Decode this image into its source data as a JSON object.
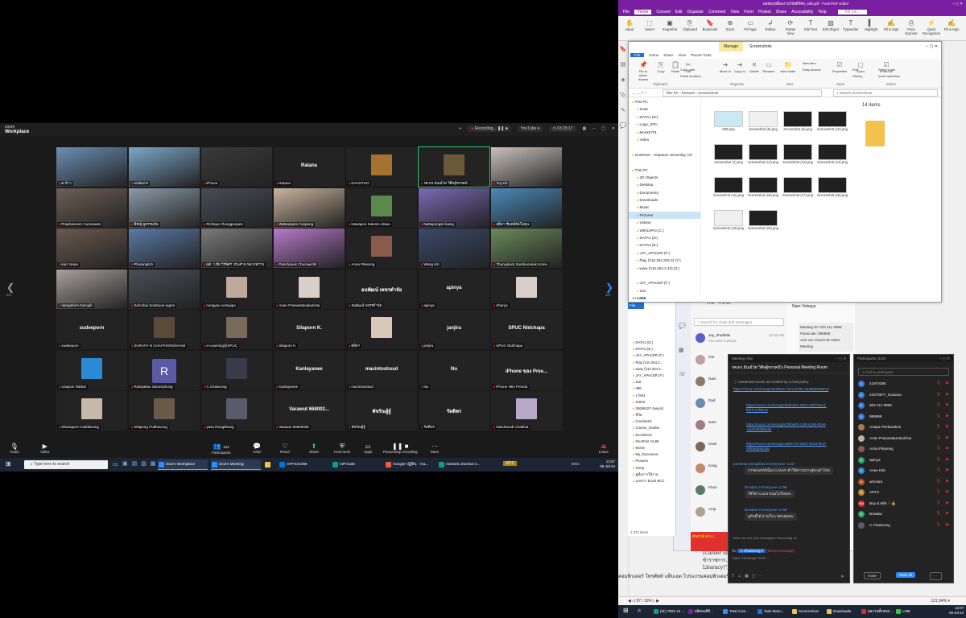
{
  "zoom": {
    "brand_small": "zoom",
    "brand": "Workplace",
    "recording": "Recording...",
    "youtube": "YouTube",
    "timer": "03:29:17",
    "page_left": "1/2",
    "page_right": "1/2",
    "tiles": [
      {
        "label": "ต.ข้าว",
        "photo": "#6b8fb3"
      },
      {
        "label": "Kittikal R",
        "photo": "#7aa8c9"
      },
      {
        "label": "iPhone",
        "photo": "#3a3a3a"
      },
      {
        "label": "Ratana",
        "big": "Ratana"
      },
      {
        "label": "KHAOTOO",
        "thumb": "#a5732f"
      },
      {
        "label": "รศ.ดร.ธันณ์วัต วิศิษฐ์ทรรศน์",
        "thumb": "#6a5a3a",
        "active": true
      },
      {
        "label": "Yuy Kit",
        "photo": "#c9c2bd"
      },
      {
        "label": "Praphansorn Cumnawat",
        "photo": "#6d5f54"
      },
      {
        "label": "พิชญ์ ยูธรรมมั่น",
        "photo": "#8a9aa7"
      },
      {
        "label": "Pichaya Chongpoopen",
        "photo": "#4a4c55"
      },
      {
        "label": "Watsanpam Fanpeng",
        "photo": "#c9b39e"
      },
      {
        "label": "Nawapon Kalumn Jitsan",
        "thumb": "#5a8a4a"
      },
      {
        "label": "Nuttapongsri kaing",
        "photo": "#7a6ab5"
      },
      {
        "label": "สสิตา ชีมคอีย์อโม่ดุน",
        "photo": "#4a8ab9"
      },
      {
        "label": "karc Nana",
        "photo": "#6a5a4f"
      },
      {
        "label": "Phutanpitch",
        "photo": "#5a7aa5"
      },
      {
        "label": "ผศ. ว.ชัย วีรพิศฯ ประศาน หลวงทราม",
        "photo": "#7a7a7a"
      },
      {
        "label": "Parichanok Chumwichit",
        "photo": "#b87acc"
      },
      {
        "label": "Anna Pilasong",
        "thumb": "#8a5a4a"
      },
      {
        "label": "Wong Kiti",
        "photo": "#3a4a6a"
      },
      {
        "label": "Thunyaluck Somboonsuk Koreo",
        "photo": "#6a8a5a"
      },
      {
        "label": "Vanaphorn Damjab",
        "photo": "#a8a0a0"
      },
      {
        "label": "Somchai Somboon-ngern",
        "photo": "#4a4f55"
      },
      {
        "label": "nongyao somjaipo",
        "thumb": "#c0a89a"
      },
      {
        "label": "Anan Praewattanakulchai",
        "thumb": "#d8d0c8"
      },
      {
        "label": "อนพัฒน์ เพชรดำจัย",
        "big": "อนพัฒน์ เพชรดำจัย"
      },
      {
        "label": "apinya",
        "big": "apinya"
      },
      {
        "label": "Sharya",
        "thumb": "#d8d0c8"
      },
      {
        "label": "sudeeporn",
        "big": "sudeeporn"
      },
      {
        "label": "SURATH N CHAITHONGKHAM",
        "thumb": "#5a4a3a"
      },
      {
        "label": "e-Learning@SPUC",
        "thumb": "#7a6a5a"
      },
      {
        "label": "Silaporn  K.",
        "big": "Silaporn  K."
      },
      {
        "label": "ศุลิตา",
        "thumb": "#d8c8b8"
      },
      {
        "label": "janjira",
        "big": "janjira"
      },
      {
        "label": "SPUC Nidchapa",
        "big": "SPUC Nidchapa"
      },
      {
        "label": "Urapom Rattra!",
        "thumb": "#2a8ad5"
      },
      {
        "label": "Rattiyakan Samerphong",
        "letter": "R"
      },
      {
        "label": "C.Chaiarong",
        "thumb": "#3a3a4a"
      },
      {
        "label": "Kanlayanee",
        "big": "Kanlayanee"
      },
      {
        "label": "macintoshssd",
        "big": "macintoshssd"
      },
      {
        "label": "Nu",
        "big": "Nu"
      },
      {
        "label": "iPhone ของ Preeda",
        "big": "iPhone ของ Pree..."
      },
      {
        "label": "Dhanaporn Kaiklaivong",
        "thumb": "#c8b8a8"
      },
      {
        "label": "Sittipong Putthavong",
        "thumb": "#6a5a4a"
      },
      {
        "label": "yasa thongkhang",
        "thumb": "#5a5a6a"
      },
      {
        "label": "Varawut 66800005",
        "big": "Varawut 668002..."
      },
      {
        "label": "พัชรัณฐ์ฐ์",
        "big": "พัชรัณฐ์ฐ์"
      },
      {
        "label": "รัตติพร",
        "big": "รัตติพร"
      },
      {
        "label": "Natcharedt Chakhat",
        "thumb": "#b8a8c8"
      }
    ],
    "toolbar": {
      "audio": "Audio",
      "video": "Video",
      "participants": "Participants",
      "participants_count": "124",
      "chat": "Chat",
      "react": "React",
      "share": "Share",
      "host_tools": "Host tools",
      "apps": "Apps",
      "record": "Pause/stop recording",
      "more": "More",
      "leave": "Leave"
    }
  },
  "taskbar_left": {
    "search": "Type here to search",
    "apps": [
      {
        "label": "Zoom Workplace",
        "color": "#2d8cff",
        "on": true
      },
      {
        "label": "Zoom Meeting",
        "color": "#2d8cff",
        "on": true
      },
      {
        "label": "",
        "color": "#f4c542"
      },
      {
        "label": "OFFICE365",
        "color": "#0078d4"
      },
      {
        "label": "InPrivate",
        "color": "#0e9d8c"
      },
      {
        "label": "Google ปฏิทิน - ma...",
        "color": "#f15b40"
      },
      {
        "label": "misweb.chonbur.s...",
        "color": "#0e9d8c"
      }
    ],
    "weather": "32°C",
    "lang": "ENG",
    "time": "12:07",
    "date": "06-Jul-24"
  },
  "pdf": {
    "title": "ผลสัมฤทธิ์ผลงานวิจัยดิจิทัล_edit.pdf - Foxit PDF Editor",
    "menus": [
      "File",
      "Home",
      "Convert",
      "Edit",
      "Organize",
      "Comment",
      "View",
      "Form",
      "Protect",
      "Share",
      "Accessibility",
      "Help"
    ],
    "tell_me": "Tell me...",
    "ribbon": [
      "Hand",
      "Select",
      "SnapShot",
      "Clipboard",
      "Bookmark",
      "Zoom",
      "Fit Page",
      "Reflow",
      "Rotate View",
      "Edit Text",
      "Edit Object",
      "Typewriter",
      "Highlight",
      "Fill & Sign",
      "From Scanner",
      "Quick Recognition",
      "Fill & Sign"
    ],
    "doc_lines": [
      "(Career an...",
      "ข้าราชการ...",
      "Literacy)\"...",
      "คอมพิวเตอร์ โทรศัพท์ แท็บเลต โปรแกรมคอมพิวเตอร์ และสื่อออนไลน์ มาใช้ให้เกิดประโยชน์สูงสุด"
    ],
    "page": "97 / 324",
    "zoom_level": "121.94%"
  },
  "explorer": {
    "title": "Screenshots",
    "manage": "Manage",
    "tabs": [
      "File",
      "Home",
      "Share",
      "View",
      "Picture Tools"
    ],
    "ribbon": [
      "Pin to Quick access",
      "Copy",
      "Paste",
      "Cut",
      "Copy path",
      "Paste shortcut",
      "Move to",
      "Copy to",
      "Delete",
      "Rename",
      "New folder",
      "New item",
      "Easy access",
      "Properties",
      "Open",
      "Edit",
      "History",
      "Select all",
      "Select none",
      "Invert selection"
    ],
    "groups": [
      "Clipboard",
      "Organize",
      "New",
      "Open",
      "Select"
    ],
    "path": "This PC  ›  Pictures  ›  Screenshots",
    "search": "Search Screenshots",
    "count": "14 items",
    "nav": [
      "This PC",
      "Scan",
      "DATA1 (D:)",
      "Logo_SPU",
      "Monkh701",
      "Video",
      "",
      "OneDrive - Sripatum University, Ch",
      "",
      "This PC",
      "3D Objects",
      "Desktop",
      "Documents",
      "Downloads",
      "Music",
      "Pictures",
      "Videos",
      "WIN10Pro (C:)",
      "DATA1 (D:)",
      "DATA2 (E:)",
      "JAY_APACER (F:)",
      "Pjay (\\\\10.254.202.2) (Y:)",
      "www (\\\\10.254.2.43) (Z:)",
      "",
      "JAY_APACER (F:)",
      "118",
      "498"
    ],
    "files": [
      {
        "name": "838.png",
        "c": "#cde8f5"
      },
      {
        "name": "Screenshot (9).png",
        "c": "#f0f0f0"
      },
      {
        "name": "Screenshot (6).png",
        "c": "#202020"
      },
      {
        "name": "Screenshot (10).png",
        "c": "#202020"
      },
      {
        "name": "Screenshot (1).png",
        "c": "#202020"
      },
      {
        "name": "Screenshot (12).png",
        "c": "#202020"
      },
      {
        "name": "Screenshot (13).png",
        "c": "#202020"
      },
      {
        "name": "Screenshot (14).png",
        "c": "#202020"
      },
      {
        "name": "Screenshot (15).png",
        "c": "#202020"
      },
      {
        "name": "Screenshot (16).png",
        "c": "#202020"
      },
      {
        "name": "Screenshot (17).png",
        "c": "#202020"
      },
      {
        "name": "Screenshot (18).png",
        "c": "#202020"
      },
      {
        "name": "Screenshot (19).png",
        "c": "#f0f0f0"
      },
      {
        "name": "Screenshot (20).png",
        "c": "#202020"
      }
    ],
    "status": "14 items"
  },
  "explorer2": {
    "rows": [
      "DATA1 (D:)",
      "DATA2 (E:)",
      "JAY_APACER (F:)",
      "Pjay (\\\\10.254.2...",
      "www (\\\\10.254.2...",
      "JAY_APACER (F:)",
      "118",
      "498",
      "17804",
      "11810",
      "25658427-Jaeyod",
      "ชีวิต",
      "Condo610",
      "Course_Outline",
      "Excel2013",
      "FlexPrint 10.89",
      "Movie",
      "My_Document",
      "Pictures",
      "Temp",
      "คู่มือการใช้งาน",
      "เอกสาร Excel BCC"
    ],
    "status": "1,373 items"
  },
  "teams": {
    "tab_chat": "Chat",
    "tab_friends": "Friends",
    "search": "Search for chats and messages",
    "contacts": [
      {
        "name": "Jay_iPadMini",
        "preview": "You sent a photo.",
        "time": "11:03 AM"
      },
      {
        "name": "Om",
        "preview": "",
        "time": ""
      },
      {
        "name": "Nam",
        "preview": "",
        "time": ""
      },
      {
        "name": "Dad",
        "preview": "",
        "time": ""
      },
      {
        "name": "Nam",
        "preview": "",
        "time": ""
      },
      {
        "name": "Orak",
        "preview": "",
        "time": ""
      },
      {
        "name": "Kong",
        "preview": "",
        "time": ""
      },
      {
        "name": "Khun",
        "preview": "",
        "time": ""
      },
      {
        "name": "Amp",
        "preview": "",
        "time": ""
      }
    ],
    "chat_title": "Nam Yotsaya",
    "meeting_id": "Meeting ID: 603 411 9999",
    "passcode": "Passcode: 999999",
    "join": "Join our Cloud HD Video Meeting",
    "promo": "ค้นหาดี 60 LI..."
  },
  "mchat": {
    "title": "Meeting chat",
    "room": "รศ.ดร.ธันณ์วัต วิศิษฐ์ทรรศน์'s Personal Meeting Room",
    "notice": "Unwanted words are limited by a chat policy",
    "links": [
      "https://suno.com/song/c8e3f5a4-7e71-b79b-3a2b6b05551a",
      "https://suno.com/song/e6bbc861-dd41-45fd-b8cd-fbb7cc1f81c8",
      "https://suno.com/song/a7db0a0f-41b0-4246-82e9-ea46d2dabe5e",
      "https://suno.com/song/c1dee749-2b01-4b33-9b1f-09f0652852d8"
    ],
    "m1_from": "pornthep semgblow to Everyone 11:57",
    "m1_text": "การลงเดรท์เนื่อง CANVA ทำให้ความบางสุดๆเท่าไหม",
    "m2_from": "Bosaba to Everyone 11:58",
    "m2_text": "ใช้ใคร count ขนมไม่ใหมดะ",
    "m3_from": "Bosaba to Everyone 11:58",
    "m3_text": "ลูกับที่ได้ อ่างเก็บๆ ขอบคุณคะ",
    "who": "Who can see your messages? Recording on",
    "to_label": "To:",
    "to_target": "C.Chaiarong",
    "direct": "(Direct message)",
    "placeholder": "Type message here..."
  },
  "participants": {
    "title": "Participants (124)",
    "search": "Find a participant",
    "list": [
      {
        "name": "41970385",
        "c": "#3a7bd5",
        "i": "4"
      },
      {
        "name": "41970677_Kusuma",
        "c": "#3a7bd5",
        "i": "4"
      },
      {
        "name": "603 411 9999",
        "c": "#3a7bd5",
        "i": "6"
      },
      {
        "name": "999999",
        "c": "#3a7bd5",
        "i": "9"
      },
      {
        "name": "Anapa Phettarakos",
        "c": "#a87a5a",
        "i": ""
      },
      {
        "name": "Anan Praewattanakulchai",
        "c": "#c0b0a0",
        "i": ""
      },
      {
        "name": "Anna Pilasong",
        "c": "#8a5a4a",
        "i": ""
      },
      {
        "name": "apinya",
        "c": "#2aa86a",
        "i": "A"
      },
      {
        "name": "Anee  Kkk",
        "c": "#2a8ad5",
        "i": "A"
      },
      {
        "name": "aricsara",
        "c": "#c0502a",
        "i": "A"
      },
      {
        "name": "ARTS",
        "c": "#c08a2a",
        "i": "A"
      },
      {
        "name": "Boy & Milk ♡🔒",
        "c": "#d03030",
        "i": "BM"
      },
      {
        "name": "Bosaba",
        "c": "#2aa86a",
        "i": "B"
      },
      {
        "name": "C.Chaiarong",
        "c": "#5a5a6a",
        "i": ""
      }
    ],
    "invite": "Invite",
    "mute_all": "Mute all"
  },
  "taskbar_right": {
    "apps": [
      {
        "label": "(M) กรมบ 15 ...",
        "color": "#0e9d8c"
      },
      {
        "label": "ผลิตผลดิจิ...",
        "color": "#7b1fa2"
      },
      {
        "label": "Total Com...",
        "color": "#2d8cff"
      },
      {
        "label": "Task Manu...",
        "color": "#1e6fd9"
      },
      {
        "label": "Screenshots",
        "color": "#f2c14e"
      },
      {
        "label": "Downloads",
        "color": "#f2c14e"
      },
      {
        "label": "ผลงานทั้งหมด...",
        "color": "#d03030"
      },
      {
        "label": "LINE",
        "color": "#2ecc40"
      }
    ],
    "time": "12:07",
    "date": "06-Jul-24"
  }
}
